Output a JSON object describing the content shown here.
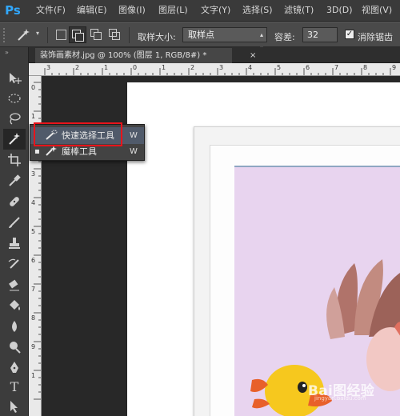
{
  "app": {
    "logo": "Ps"
  },
  "menu": [
    "文件(F)",
    "编辑(E)",
    "图像(I)",
    "图层(L)",
    "文字(Y)",
    "选择(S)",
    "滤镜(T)",
    "3D(D)",
    "视图(V)"
  ],
  "options": {
    "sample_size_label": "取样大小:",
    "sample_size_value": "取样点",
    "tolerance_label": "容差:",
    "tolerance_value": "32",
    "antialias_label": "消除锯齿",
    "antialias_checked": true
  },
  "tab": {
    "title": "装饰画素材.jpg @ 100% (图层 1, RGB/8#) *",
    "close": "×"
  },
  "ruler_top": [
    "3",
    "2",
    "1",
    "0",
    "1",
    "2",
    "3",
    "4",
    "5",
    "6",
    "7",
    "8",
    "9"
  ],
  "ruler_left": [
    "0",
    "1",
    "2",
    "3",
    "4",
    "5",
    "6",
    "7",
    "8",
    "9",
    "1"
  ],
  "flyout": {
    "items": [
      {
        "label": "快速选择工具",
        "shortcut": "W",
        "icon": "quick-selection-icon",
        "highlighted": true
      },
      {
        "label": "魔棒工具",
        "shortcut": "W",
        "icon": "magic-wand-icon",
        "active": true
      }
    ]
  },
  "watermark": {
    "text": "Bai图经验",
    "sub": "jingyan.baidu.com"
  },
  "colors": {
    "accent": "#31a8ff",
    "highlight_box": "#e8141b",
    "artwork_bg": "#e8d4ef"
  }
}
